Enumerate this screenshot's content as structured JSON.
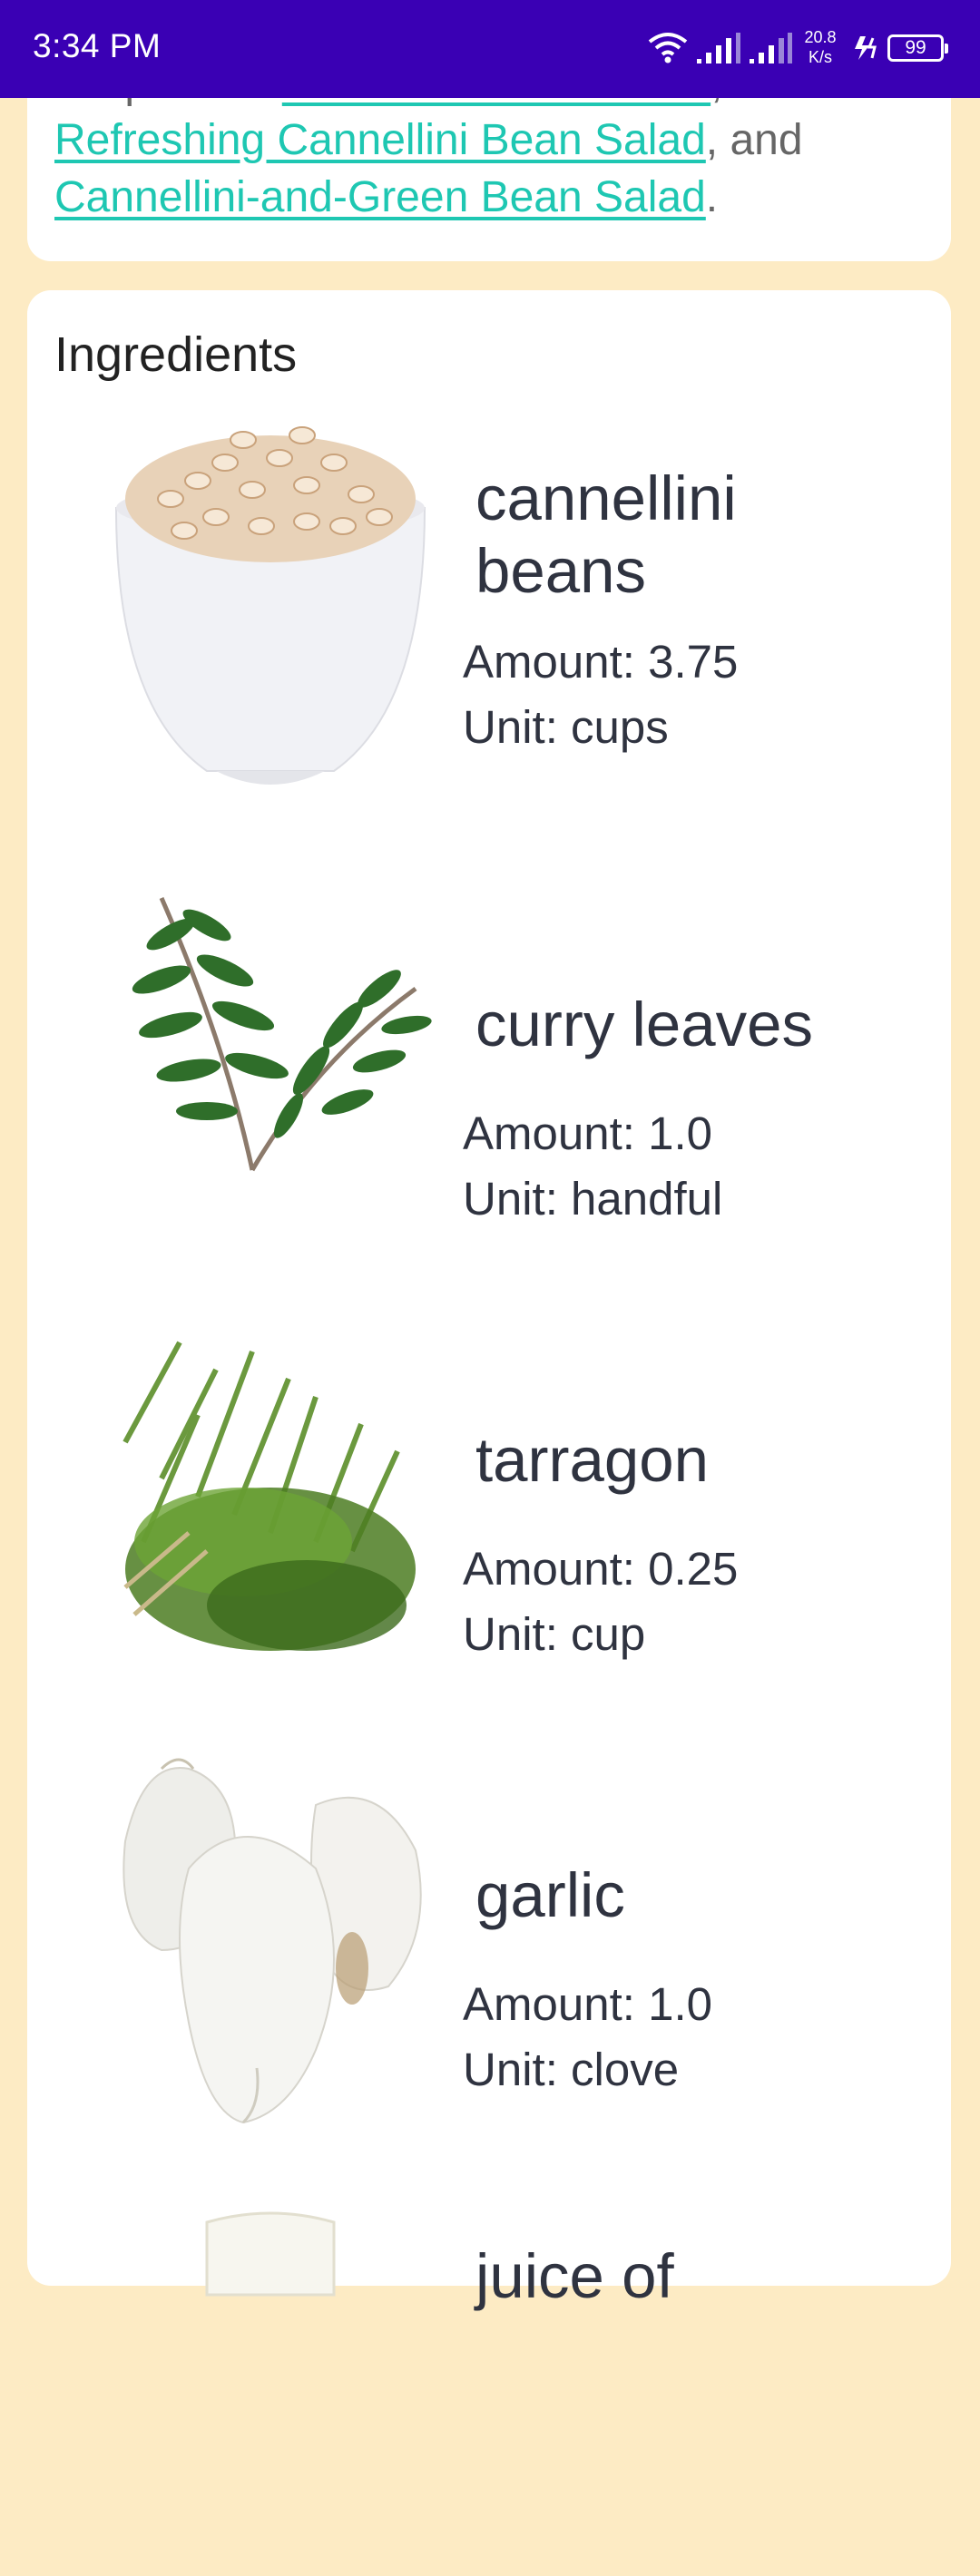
{
  "status_bar": {
    "time": "3:34 PM",
    "speed_value": "20.8",
    "speed_unit": "K/s",
    "battery": "99",
    "icons": [
      "wifi-icon",
      "signal-icon",
      "signal-icon",
      "charging-icon",
      "battery-icon"
    ]
  },
  "summary": {
    "prefix": "recipes are ",
    "link1": "Cannellini Bean Salad",
    "sep1": ",",
    "link2": "Refreshing Cannellini Bean Salad",
    "sep2": ", and",
    "link3": "Cannellini-and-Green Bean Salad",
    "end": "."
  },
  "ingredients": {
    "title": "Ingredients",
    "items": [
      {
        "name": "cannellini beans",
        "amount": "Amount: 3.75",
        "unit": "Unit: cups",
        "image": "bowl-of-beans"
      },
      {
        "name": "curry leaves",
        "amount": "Amount: 1.0",
        "unit": "Unit: handful",
        "image": "curry-leaves-sprig"
      },
      {
        "name": "tarragon",
        "amount": "Amount: 0.25",
        "unit": "Unit: cup",
        "image": "tarragon-bunch"
      },
      {
        "name": "garlic",
        "amount": "Amount: 1.0",
        "unit": "Unit: clove",
        "image": "garlic-cloves"
      },
      {
        "name": "juice of",
        "amount": "",
        "unit": "",
        "image": "glass-jar"
      }
    ]
  },
  "colors": {
    "status_bar": "#3a00b4",
    "background": "#fdebc4",
    "link": "#1ec7b2",
    "text": "#2f3340"
  }
}
